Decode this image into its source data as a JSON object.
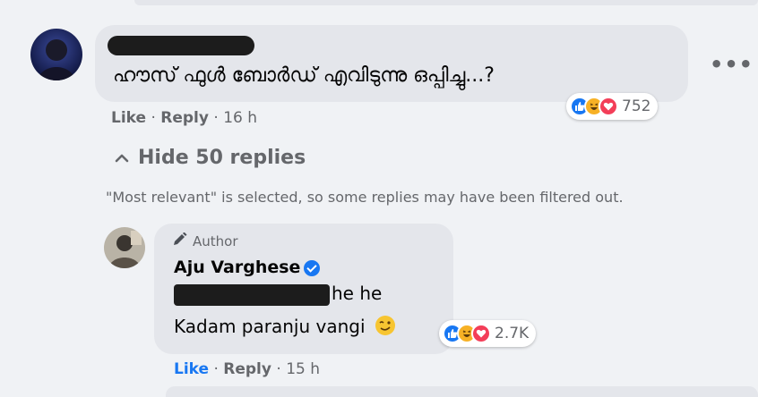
{
  "comment": {
    "text": "ഹൗസ് ഫുൾ ബോർഡ് എവിടുന്നു ഒപ്പിച്ചു...?",
    "reaction_count": "752",
    "actions": {
      "like": "Like",
      "reply": "Reply",
      "time": "16 h"
    }
  },
  "thread": {
    "hide_replies_label": "Hide 50 replies",
    "filter_note": "\"Most relevant\" is selected, so some replies may have been filtered out."
  },
  "reply": {
    "badge_label": "Author",
    "author_name": "Aju Varghese",
    "line1_text": "he he",
    "line2_text": "Kadam paranju vangi",
    "reaction_count": "2.7K",
    "actions": {
      "like": "Like",
      "reply": "Reply",
      "time": "15 h"
    }
  },
  "icons": [
    "like-icon",
    "haha-icon",
    "love-icon",
    "pencil-icon",
    "verified-icon",
    "wink-emoji-icon",
    "chevron-up-icon",
    "more-options-icon"
  ],
  "colors": {
    "like_blue": "#1877f2",
    "love_red": "#f33e58",
    "haha_yellow": "#f7b125",
    "bubble_gray": "#e4e6eb",
    "meta_gray": "#65676b"
  }
}
